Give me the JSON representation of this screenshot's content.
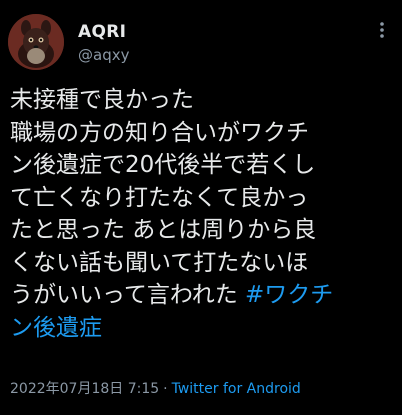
{
  "tweet": {
    "author": {
      "display_name": "AQRI",
      "handle": "@aqxy",
      "avatar": "squirrel-avatar-icon"
    },
    "menu_icon": "more-vertical-icon",
    "text_lines": [
      "未接種で良かった",
      "職場の方の知り合いがワクチ",
      "ン後遺症で20代後半で若くし",
      "て亡くなり打たなくて良かっ",
      "たと思った あとは周りから良",
      "くない話も聞いて打たないほ",
      "うがいいって言われた "
    ],
    "hashtag_part1": "#ワクチ",
    "hashtag_part2": "ン後遺症",
    "timestamp": "2022年07月18日 7:15",
    "separator": "·",
    "source": "Twitter for Android"
  },
  "colors": {
    "background": "#000000",
    "text": "#e7e9ea",
    "secondary": "#8b98a5",
    "accent": "#1d9bf0"
  }
}
